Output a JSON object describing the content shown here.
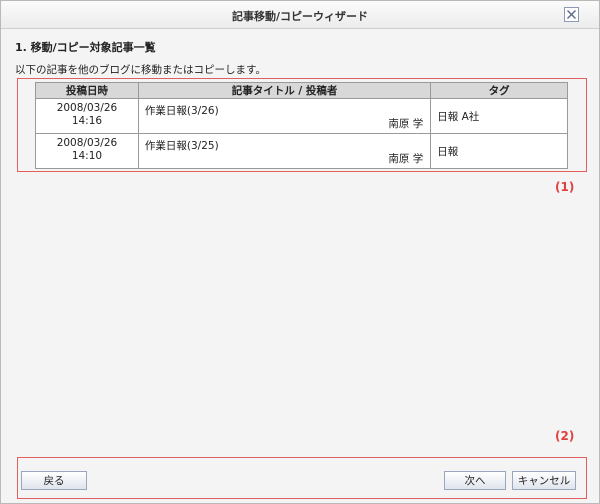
{
  "dialog": {
    "title": "記事移動/コピーウィザード"
  },
  "section": {
    "title": "1. 移動/コピー対象記事一覧",
    "description": "以下の記事を他のブログに移動またはコピーします。"
  },
  "table": {
    "headers": [
      "投稿日時",
      "記事タイトル / 投稿者",
      "タグ"
    ],
    "rows": [
      {
        "date": "2008/03/26",
        "time": "14:16",
        "title": "作業日報(3/26)",
        "author": "南原 学",
        "tags": "日報 A社"
      },
      {
        "date": "2008/03/26",
        "time": "14:10",
        "title": "作業日報(3/25)",
        "author": "南原 学",
        "tags": "日報"
      }
    ]
  },
  "markers": {
    "one": "(1)",
    "two": "(2)"
  },
  "buttons": {
    "back": "戻る",
    "next": "次へ",
    "cancel": "キャンセル"
  },
  "icons": {
    "close": "close-icon"
  }
}
